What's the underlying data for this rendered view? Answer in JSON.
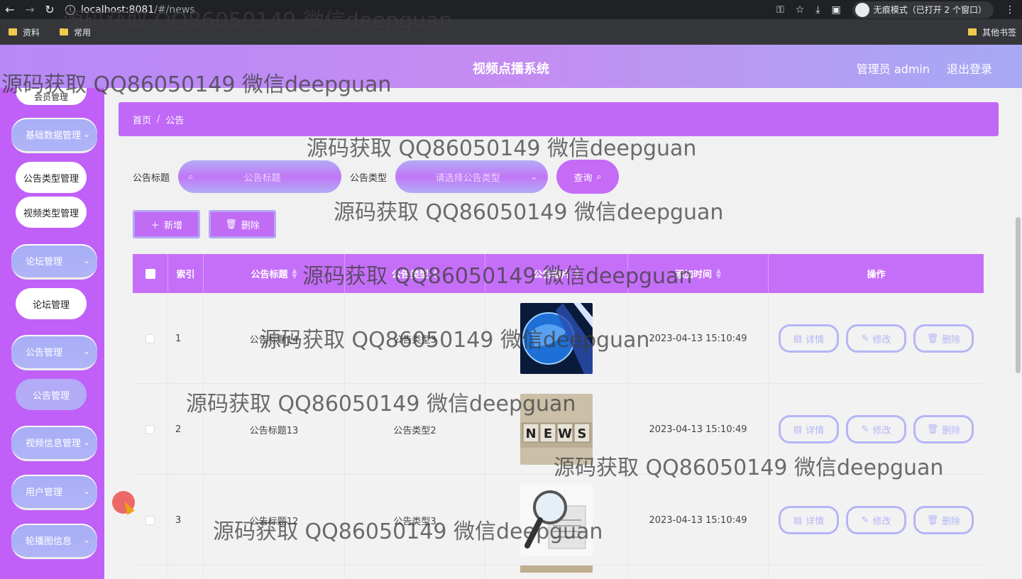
{
  "browser": {
    "url_host": "localhost:8081",
    "url_path": "/#/news",
    "incognito_label": "无痕模式（已打开 2 个窗口）",
    "bookmarks": [
      "资料",
      "常用"
    ],
    "bookmarks_right": "其他书签"
  },
  "header": {
    "title": "视频点播系统",
    "user": "管理员 admin",
    "logout": "退出登录"
  },
  "sidebar": {
    "top_partial": "会员管理",
    "items": [
      {
        "label": "基础数据管理",
        "type": "group"
      },
      {
        "label": "公告类型管理",
        "type": "sub"
      },
      {
        "label": "视频类型管理",
        "type": "sub"
      },
      {
        "label": "论坛管理",
        "type": "group"
      },
      {
        "label": "论坛管理",
        "type": "sub"
      },
      {
        "label": "公告管理",
        "type": "group"
      },
      {
        "label": "公告管理",
        "type": "sub",
        "active": true
      },
      {
        "label": "视频信息管理",
        "type": "group"
      },
      {
        "label": "用户管理",
        "type": "group"
      },
      {
        "label": "轮播图信息",
        "type": "group"
      }
    ]
  },
  "breadcrumb": {
    "home": "首页",
    "separator": "/",
    "current": "公告"
  },
  "search": {
    "title_label": "公告标题",
    "title_placeholder": "公告标题",
    "type_label": "公告类型",
    "type_placeholder": "请选择公告类型",
    "query_label": "查询"
  },
  "actions": {
    "add_label": "新增",
    "delete_label": "删除"
  },
  "table": {
    "columns": [
      "索引",
      "公告标题",
      "公告类型",
      "公告图片",
      "添加时间",
      "操作"
    ],
    "rows": [
      {
        "index": "1",
        "title": "公告标题14",
        "type": "公告类型3",
        "time": "2023-04-13 15:10:49"
      },
      {
        "index": "2",
        "title": "公告标题13",
        "type": "公告类型2",
        "time": "2023-04-13 15:10:49"
      },
      {
        "index": "3",
        "title": "公告标题12",
        "type": "公告类型3",
        "time": "2023-04-13 15:10:49"
      }
    ],
    "op_labels": {
      "detail": "详情",
      "edit": "修改",
      "delete": "删除"
    }
  },
  "watermark": "源码获取 QQ86050149 微信deepguan"
}
